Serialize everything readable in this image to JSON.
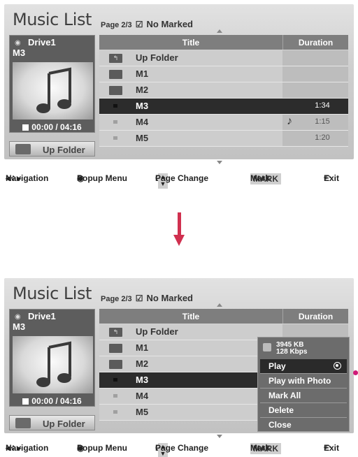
{
  "title": "Music List",
  "page_info": "Page 2/3",
  "marked_status": "No Marked",
  "drive": "Drive1",
  "selected_file": "M3",
  "playback_time": "00:00 / 04:16",
  "up_folder_button": "Up Folder",
  "columns": {
    "title": "Title",
    "duration": "Duration"
  },
  "rows": [
    {
      "title": "Up Folder",
      "duration": "",
      "type": "up-folder"
    },
    {
      "title": "M1",
      "duration": "",
      "type": "folder"
    },
    {
      "title": "M2",
      "duration": "",
      "type": "folder"
    },
    {
      "title": "M3",
      "duration": "1:34",
      "type": "file"
    },
    {
      "title": "M4",
      "duration": "1:15",
      "type": "file"
    },
    {
      "title": "M5",
      "duration": "1:20",
      "type": "file"
    }
  ],
  "legend": {
    "navigation": "Navigation",
    "popup_menu": "Popup Menu",
    "ch": "CH",
    "page_change": "Page Change",
    "mark_key": "MARK",
    "mark": "Mark",
    "exit": "Exit"
  },
  "popup": {
    "file_size": "3945 KB",
    "bitrate": "128 Kbps",
    "items": [
      "Play",
      "Play with Photo",
      "Mark All",
      "Delete",
      "Close"
    ]
  },
  "colors": {
    "highlight_row": "#2c2c2c",
    "arrow": "#d0304f",
    "popup_bg": "#6c6c6c"
  }
}
